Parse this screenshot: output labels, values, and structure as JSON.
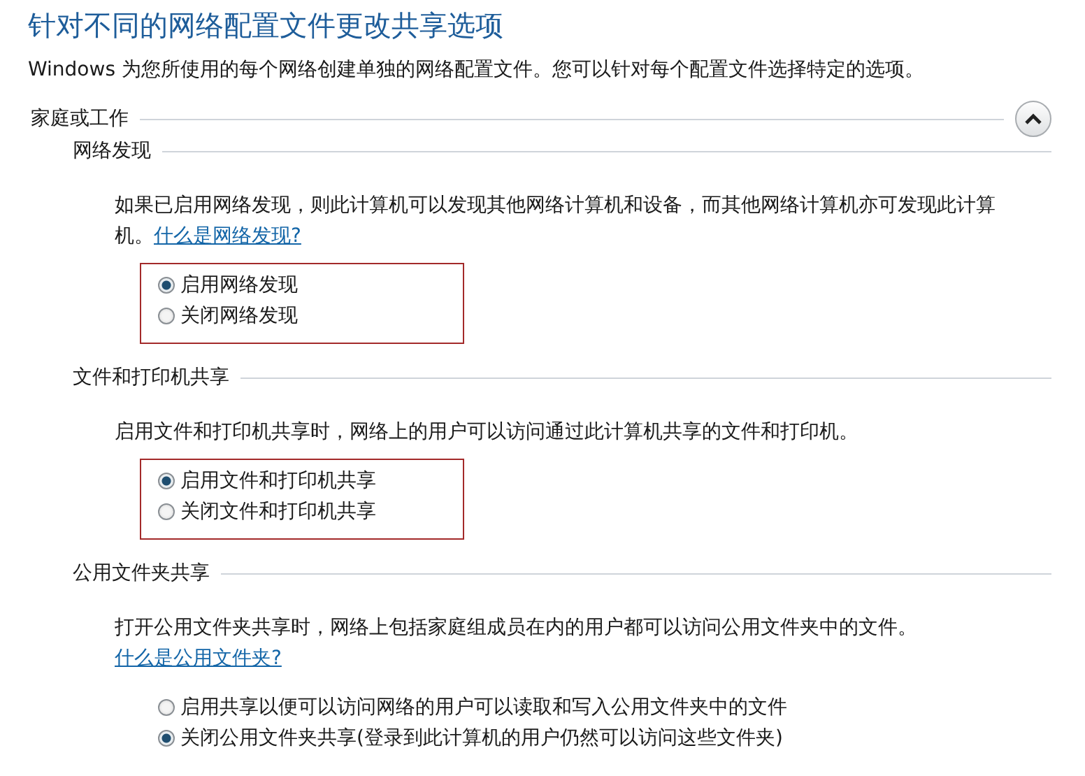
{
  "title": "针对不同的网络配置文件更改共享选项",
  "description": "Windows 为您所使用的每个网络创建单独的网络配置文件。您可以针对每个配置文件选择特定的选项。",
  "group": {
    "label": "家庭或工作",
    "expanded": true
  },
  "sections": [
    {
      "heading": "网络发现",
      "text": "如果已启用网络发现，则此计算机可以发现其他网络计算机和设备，而其他网络计算机亦可发现此计算机。",
      "link": "什么是网络发现?",
      "highlighted": true,
      "options": [
        {
          "label": "启用网络发现",
          "selected": true
        },
        {
          "label": "关闭网络发现",
          "selected": false
        }
      ]
    },
    {
      "heading": "文件和打印机共享",
      "text": "启用文件和打印机共享时，网络上的用户可以访问通过此计算机共享的文件和打印机。",
      "highlighted": true,
      "options": [
        {
          "label": "启用文件和打印机共享",
          "selected": true
        },
        {
          "label": "关闭文件和打印机共享",
          "selected": false
        }
      ]
    },
    {
      "heading": "公用文件夹共享",
      "text": "打开公用文件夹共享时，网络上包括家庭组成员在内的用户都可以访问公用文件夹中的文件。",
      "link": "什么是公用文件夹?",
      "highlighted": false,
      "options": [
        {
          "label": "启用共享以便可以访问网络的用户可以读取和写入公用文件夹中的文件",
          "selected": false
        },
        {
          "label": "关闭公用文件夹共享(登录到此计算机的用户仍然可以访问这些文件夹)",
          "selected": true
        }
      ]
    }
  ]
}
